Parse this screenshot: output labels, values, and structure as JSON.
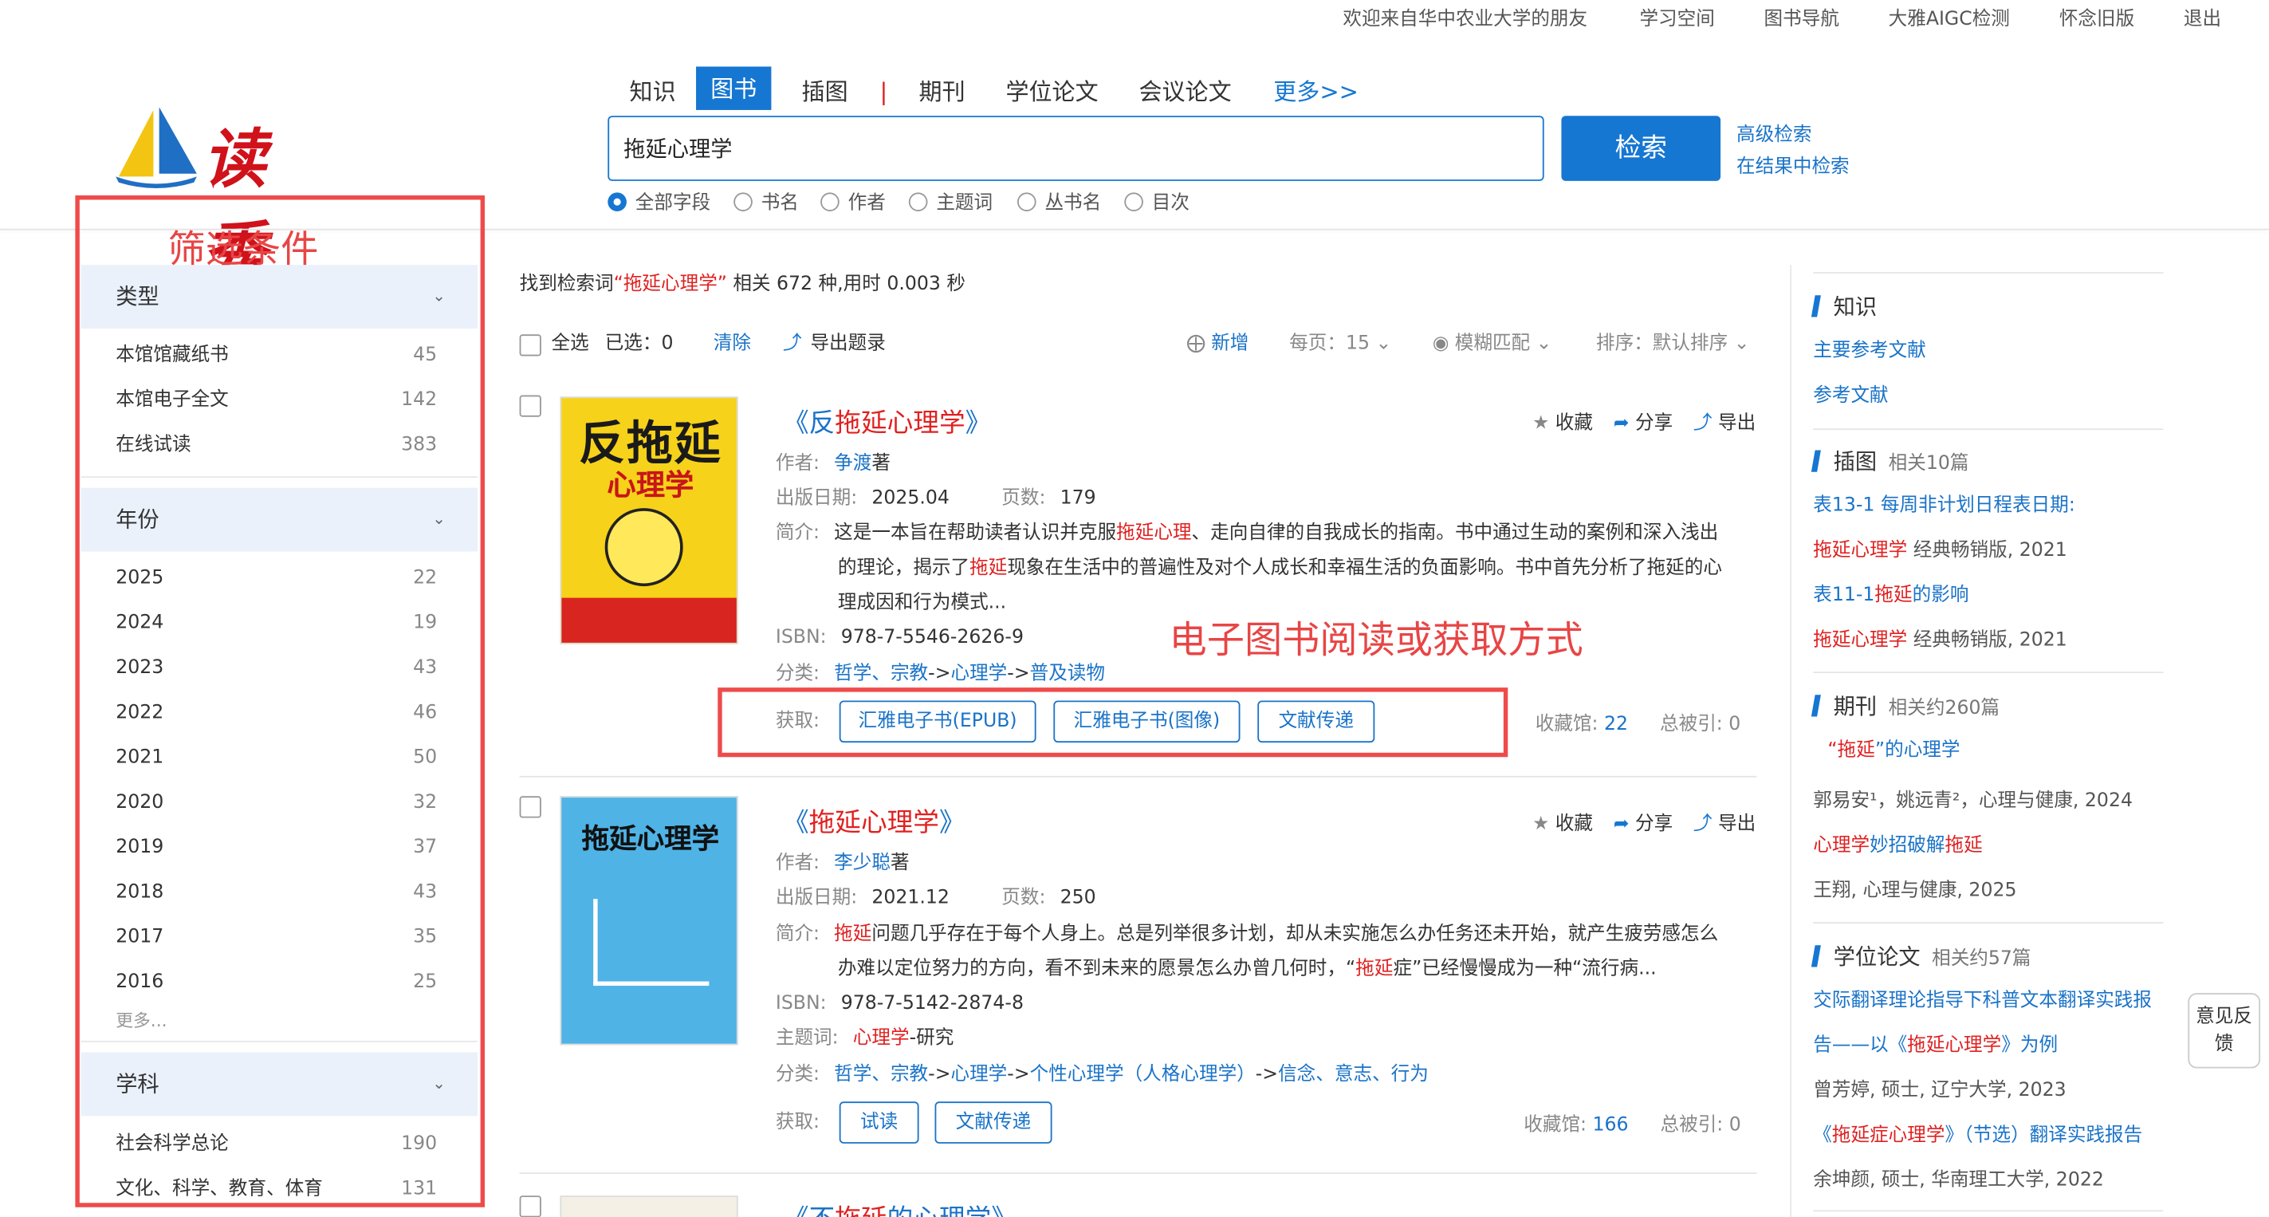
{
  "top_links": [
    "欢迎来自华中农业大学的朋友",
    "学习空间",
    "图书导航",
    "大雅AIGC检测",
    "怀念旧版",
    "退出"
  ],
  "logo_text": "读秀",
  "tabs": [
    "知识",
    "图书",
    "插图",
    "|",
    "期刊",
    "学位论文",
    "会议论文",
    "更多>>"
  ],
  "search": {
    "query": "拖延心理学",
    "button": "检索",
    "advanced": "高级检索",
    "within": "在结果中检索"
  },
  "fields": [
    "全部字段",
    "书名",
    "作者",
    "主题词",
    "丛书名",
    "目次"
  ],
  "sidebar": {
    "annotation": "筛选条件",
    "type": {
      "title": "类型",
      "items": [
        {
          "label": "本馆馆藏纸书",
          "count": "45"
        },
        {
          "label": "本馆电子全文",
          "count": "142"
        },
        {
          "label": "在线试读",
          "count": "383"
        }
      ]
    },
    "year": {
      "title": "年份",
      "items": [
        {
          "label": "2025",
          "count": "22"
        },
        {
          "label": "2024",
          "count": "19"
        },
        {
          "label": "2023",
          "count": "43"
        },
        {
          "label": "2022",
          "count": "46"
        },
        {
          "label": "2021",
          "count": "50"
        },
        {
          "label": "2020",
          "count": "32"
        },
        {
          "label": "2019",
          "count": "37"
        },
        {
          "label": "2018",
          "count": "43"
        },
        {
          "label": "2017",
          "count": "35"
        },
        {
          "label": "2016",
          "count": "25"
        }
      ],
      "more": "更多..."
    },
    "subject": {
      "title": "学科",
      "items": [
        {
          "label": "社会科学总论",
          "count": "190"
        },
        {
          "label": "文化、科学、教育、体育",
          "count": "131"
        }
      ]
    }
  },
  "summary": {
    "pre": "找到检索词",
    "term": "“拖延心理学”",
    "post": "相关 672 种,用时 0.003 秒"
  },
  "toolbar": {
    "select_all": "全选",
    "selected": "已选：0",
    "clear": "清除",
    "export": "导出题录",
    "add": "新增",
    "per_page": "每页：15",
    "fuzzy": "模糊匹配",
    "sort": "排序：默认排序"
  },
  "actions": {
    "fav": "收藏",
    "share": "分享",
    "export": "导出"
  },
  "labels": {
    "author": "作者:",
    "date": "出版日期:",
    "pages": "页数:",
    "intro": "简介:",
    "isbn": "ISBN:",
    "class": "分类:",
    "subject": "主题词:",
    "get": "获取:",
    "holdings": "收藏馆:",
    "cited": "总被引:"
  },
  "results": [
    {
      "title_pre": "《反",
      "title_hl": "拖延心理学",
      "title_post": "》",
      "author": "争渡",
      "author_suffix": "著",
      "date": "2025.04",
      "pages": "179",
      "intro_l1a": "这是一本旨在帮助读者认识并克服",
      "intro_l1h": "拖延心理",
      "intro_l1b": "、走向自律的自我成长的指南。书中通过生动的案例和深入浅出",
      "intro_l2a": "的理论，揭示了",
      "intro_l2h": "拖延",
      "intro_l2b": "现象在生活中的普遍性及对个人成长和幸福生活的负面影响。书中首先分析了拖延的心",
      "intro_l3": "理成因和行为模式...",
      "isbn": "978-7-5546-2626-9",
      "class": [
        "哲学、宗教",
        "->",
        "心理学",
        "->",
        "普及读物"
      ],
      "get": [
        "汇雅电子书(EPUB)",
        "汇雅电子书(图像)",
        "文献传递"
      ],
      "holdings": "22",
      "cited": "0",
      "cover_title": "反拖延",
      "cover_sub": "心理学"
    },
    {
      "title_pre": "《",
      "title_hl": "拖延心理学",
      "title_post": "》",
      "author": "李少聪",
      "author_suffix": "著",
      "date": "2021.12",
      "pages": "250",
      "intro_l1h": "拖延",
      "intro_l1b": "问题几乎存在于每个人身上。总是列举很多计划，却从未实施怎么办任务还未开始，就产生疲劳感怎么",
      "intro_l2a": "办难以定位努力的方向，看不到未来的愿景怎么办曾几何时，“",
      "intro_l2h": "拖延",
      "intro_l2b": "症”已经慢慢成为一种“流行病...",
      "isbn": "978-7-5142-2874-8",
      "subject_hl": "心理学",
      "subject_rest": "-研究",
      "class": [
        "哲学、宗教",
        "->",
        "心理学",
        "->",
        "个性心理学（人格心理学）",
        "->",
        "信念、意志、行为"
      ],
      "get": [
        "试读",
        "文献传递"
      ],
      "holdings": "166",
      "cited": "0",
      "cover_title": "拖延心理学"
    },
    {
      "title_pre": "《不",
      "title_hl": "拖延",
      "title_post": "的心理学》"
    }
  ],
  "ebook_annotation": "电子图书阅读或获取方式",
  "right": {
    "knowledge": {
      "title": "知识",
      "links": [
        "主要参考文献",
        "参考文献"
      ]
    },
    "figures": {
      "title": "插图",
      "count": "相关10篇",
      "items": [
        {
          "link": "表13-1 每周非计划日程表日期:"
        },
        {
          "hl": "拖延心理学",
          "rest": " 经典畅销版, 2021"
        },
        {
          "link_a": "表11-1",
          "link_h": "拖延",
          "link_b": "的影响"
        },
        {
          "hl": "拖延心理学",
          "rest": " 经典畅销版, 2021"
        }
      ]
    },
    "journals": {
      "title": "期刊",
      "count": "相关约260篇",
      "items": [
        {
          "a": "“",
          "h": "拖延",
          "b": "”的心理学"
        },
        {
          "plain": "郭易安¹，姚远青²，心理与健康, 2024"
        },
        {
          "h1": "心理学",
          "m": "妙招破解",
          "h2": "拖延"
        },
        {
          "plain": "王翔, 心理与健康, 2025"
        }
      ]
    },
    "theses": {
      "title": "学位论文",
      "count": "相关约57篇",
      "items": [
        {
          "a": "交际翻译理论指导下科普文本翻译实践报"
        },
        {
          "a": "告——以《",
          "h": "拖延心理学",
          "b": "》为例"
        },
        {
          "plain": "曾芳婷, 硕士, 辽宁大学, 2023"
        },
        {
          "a": "《",
          "h": "拖延症心理学",
          "b": "》（节选）翻译实践报告"
        },
        {
          "plain": "余坤颜, 硕士, 华南理工大学, 2022"
        }
      ]
    }
  },
  "feedback": "意见反馈"
}
